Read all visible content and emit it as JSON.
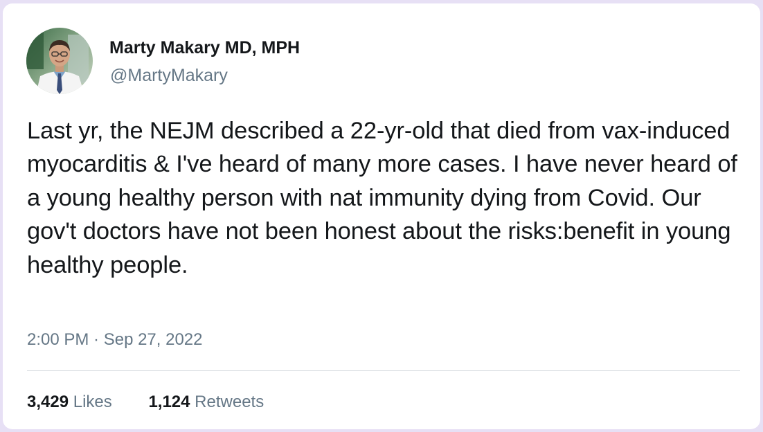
{
  "author": {
    "display_name": "Marty Makary MD, MPH",
    "handle": "@MartyMakary"
  },
  "tweet": {
    "text": "Last yr, the NEJM described a 22-yr-old that died from vax-induced myocarditis & I've heard of many more cases. I have never heard of a young healthy person with nat immunity dying from Covid. Our gov't doctors have not been honest about the risks:benefit in young healthy people.",
    "timestamp": "2:00 PM · Sep 27, 2022"
  },
  "stats": {
    "likes_count": "3,429",
    "likes_label": "Likes",
    "retweets_count": "1,124",
    "retweets_label": "Retweets"
  },
  "colors": {
    "background": "#e7e0f5",
    "card": "#ffffff",
    "text_primary": "#14171a",
    "text_secondary": "#657786"
  }
}
